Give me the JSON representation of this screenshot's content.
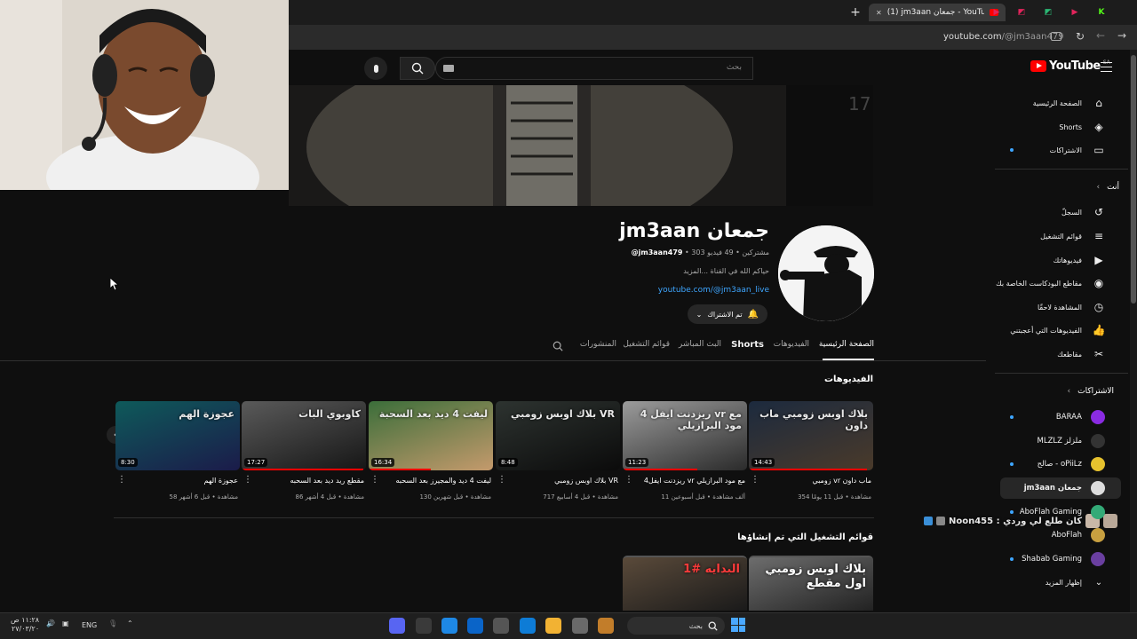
{
  "browser": {
    "active_tab_title": "(1) jm3aan جمعان - YouTube",
    "address": {
      "host": "youtube.com",
      "path": "/@jm3aan479"
    },
    "new_tab_symbol": "+",
    "close_symbol": "✕",
    "mini_tabs": [
      {
        "color": "#e2245b",
        "glyph": "▶"
      },
      {
        "color": "#e2245b",
        "glyph": "◩"
      },
      {
        "color": "#2bb673",
        "glyph": "◩"
      },
      {
        "color": "#e2245b",
        "glyph": "▶"
      },
      {
        "color": "#53fc18",
        "glyph": "K"
      }
    ]
  },
  "header": {
    "logo_text": "YouTube",
    "logo_region": "SA",
    "search_placeholder": "بحث"
  },
  "channel": {
    "name": "jm3aan جمعان",
    "handle": "@jm3aan479",
    "stats": "303 مشتركين • 49 فيديو",
    "description": "حياكم الله في القناة ...المزيد",
    "link": "youtube.com/@jm3aan_live",
    "subscribe_label": "تم الاشتراك"
  },
  "tabs": [
    {
      "label": "الصفحة الرئيسية",
      "active": true
    },
    {
      "label": "الفيديوهات",
      "active": false
    },
    {
      "label": "Shorts",
      "active": false
    },
    {
      "label": "البث المباشر",
      "active": false
    },
    {
      "label": "قوائم التشغيل",
      "active": false
    },
    {
      "label": "المنشورات",
      "active": false
    }
  ],
  "videos_section": {
    "title": "الفيديوهات",
    "items": [
      {
        "title": "زومبي vr ماب داون",
        "meta": "354 مشاهدة • قبل 11 يومًا",
        "duration": "14:43",
        "progress": 0.95,
        "overlay": "بلاك اوبس زومبي ماب داون",
        "bg": [
          "#1c2a3e",
          "#4a3a2a"
        ]
      },
      {
        "title": "ريزدنت ايفل4 vr مع مود البرازيلي",
        "meta": "11 ألف مشاهدة • قبل أسبوعين",
        "duration": "11:23",
        "progress": 0.6,
        "overlay": "ريزدنت ايفل 4 vr مع مود البرازيلي",
        "bg": [
          "#9b9b9b",
          "#2b2b2b"
        ]
      },
      {
        "title": "بلاك اوبس زومبي VR",
        "meta": "717 مشاهدة • قبل 4 أسابيع",
        "duration": "8:48",
        "progress": 0,
        "overlay": "بلاك اوبس زومبي VR",
        "bg": [
          "#2d3330",
          "#0b0b0b"
        ]
      },
      {
        "title": "ليفت 4 ديد والمجيرز بعد السحبه",
        "meta": "130 مشاهدة • قبل شهرين",
        "duration": "16:34",
        "progress": 0.5,
        "overlay": "ليفت 4 ديد بعد السحبة",
        "bg": [
          "#3b6e3a",
          "#c49a6c"
        ]
      },
      {
        "title": "مقطع ريد ديد بعد السحبه",
        "meta": "86 مشاهدة • قبل 4 أشهر",
        "duration": "17:27",
        "progress": 0.98,
        "overlay": "كاوبوي البات",
        "bg": [
          "#5a5a5a",
          "#161616"
        ]
      },
      {
        "title": "عجوزة الهم",
        "meta": "58 مشاهدة • قبل 6 أشهر",
        "duration": "8:30",
        "progress": 0,
        "overlay": "عجوزة الهم",
        "bg": [
          "#0e5a5a",
          "#1b1b4a"
        ]
      }
    ]
  },
  "playlists_section": {
    "title": "قوائم التشغيل التي تم إنشاؤها",
    "items": [
      {
        "overlay": "بلاك اوبس زومبي اول مقطع",
        "bg": [
          "#6d6d6d",
          "#222"
        ]
      },
      {
        "overlay": "البدايه #1",
        "bg": [
          "#5a4a3a",
          "#1a1a1a"
        ]
      }
    ]
  },
  "sidebar": {
    "main": [
      {
        "label": "الصفحة الرئيسية",
        "icon": "home-icon"
      },
      {
        "label": "Shorts",
        "icon": "shorts-icon"
      },
      {
        "label": "الاشتراكات",
        "icon": "subscriptions-icon",
        "dot": true
      }
    ],
    "you_header": "أنت",
    "you": [
      {
        "label": "السجلّ",
        "icon": "history-icon"
      },
      {
        "label": "قوائم التشغيل",
        "icon": "playlists-icon"
      },
      {
        "label": "فيديوهاتك",
        "icon": "your-videos-icon"
      },
      {
        "label": "مقاطع البودكاست الخاصة بك",
        "icon": "podcast-icon"
      },
      {
        "label": "المشاهدة لاحقًا",
        "icon": "watch-later-icon"
      },
      {
        "label": "الفيديوهات التي أعجبتني",
        "icon": "liked-icon"
      },
      {
        "label": "مقاطعك",
        "icon": "clips-icon"
      }
    ],
    "subs_header": "الاشتراكات",
    "subscriptions": [
      {
        "label": "BARAA",
        "color": "#8a2be2",
        "dot": true
      },
      {
        "label": "MLZLZ ملزلز",
        "color": "#333",
        "dot": false
      },
      {
        "label": "صالح - oPiiLz",
        "color": "#e6c22e",
        "dot": true
      },
      {
        "label": "jm3aan جمعان",
        "color": "#ddd",
        "dot": false,
        "active": true
      },
      {
        "label": "AboFlah Gaming",
        "color": "#3a7",
        "dot": true
      },
      {
        "label": "AboFlah",
        "color": "#c8a040",
        "dot": false
      },
      {
        "label": "Shabab Gaming",
        "color": "#6a3fa0",
        "dot": true
      }
    ],
    "show_more": "إظهار المزيد"
  },
  "chat_overlay": {
    "text": "Noon455 : كان طلع لي وردي"
  },
  "taskbar": {
    "search_label": "بحث",
    "language": "ENG",
    "time": "١١:٢٨ ص",
    "date": "٢٧/٠٣/٢٠"
  }
}
